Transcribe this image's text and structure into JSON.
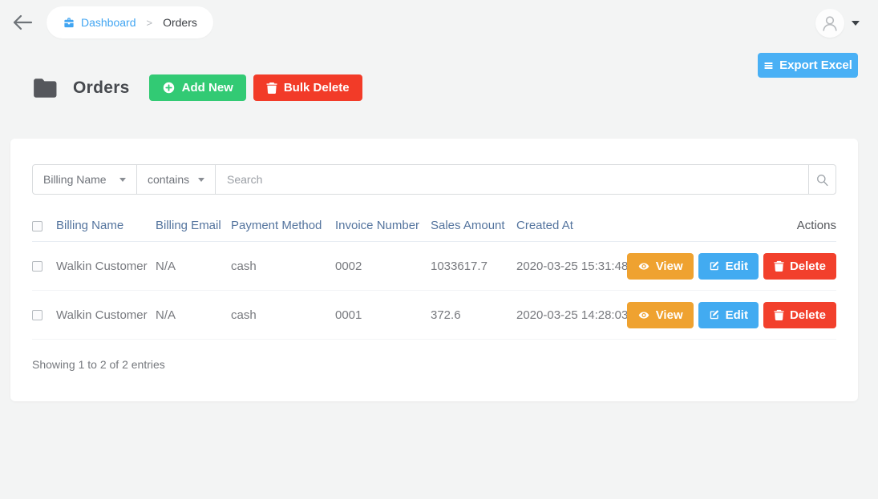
{
  "colors": {
    "accent_blue": "#42a9f1",
    "green": "#32ca74",
    "red": "#f23b28",
    "orange": "#efa230",
    "table_header_text": "#54749e",
    "page_background": "#f3f4f4"
  },
  "topbar": {
    "breadcrumb": {
      "dashboard_label": "Dashboard",
      "separator": ">",
      "current": "Orders"
    }
  },
  "header": {
    "title": "Orders",
    "add_new_label": "Add New",
    "bulk_delete_label": "Bulk Delete",
    "export_excel_label": "Export Excel"
  },
  "filter": {
    "field_selected": "Billing Name",
    "operator_selected": "contains",
    "search_placeholder": "Search"
  },
  "table": {
    "columns": [
      "Billing Name",
      "Billing Email",
      "Payment Method",
      "Invoice Number",
      "Sales Amount",
      "Created At",
      "Actions"
    ],
    "rows": [
      {
        "billing_name": "Walkin Customer",
        "billing_email": "N/A",
        "payment_method": "cash",
        "invoice_number": "0002",
        "sales_amount": "1033617.7",
        "created_at": "2020-03-25 15:31:48"
      },
      {
        "billing_name": "Walkin Customer",
        "billing_email": "N/A",
        "payment_method": "cash",
        "invoice_number": "0001",
        "sales_amount": "372.6",
        "created_at": "2020-03-25 14:28:03"
      }
    ],
    "actions": {
      "view": "View",
      "edit": "Edit",
      "delete": "Delete"
    }
  },
  "footer": {
    "summary": "Showing 1 to 2 of 2 entries"
  }
}
